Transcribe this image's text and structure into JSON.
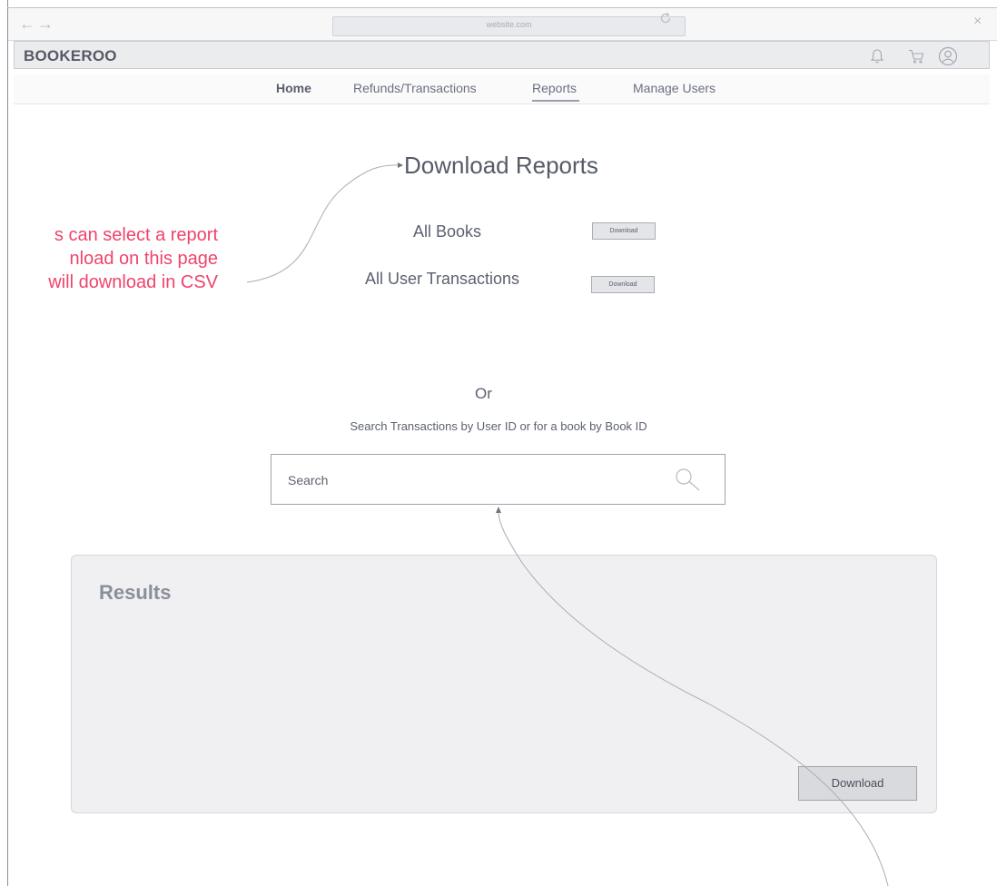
{
  "browser": {
    "url": "website.com",
    "back_glyph": "←",
    "forward_glyph": "→",
    "close_glyph": "×"
  },
  "header": {
    "brand": "BOOKEROO",
    "icons": [
      "bell-icon",
      "cart-icon",
      "user-avatar-icon"
    ]
  },
  "nav": {
    "items": [
      {
        "label": "Home",
        "active": false
      },
      {
        "label": "Refunds/Transactions",
        "active": false
      },
      {
        "label": "Reports",
        "active": true
      },
      {
        "label": "Manage Users",
        "active": false
      }
    ]
  },
  "main": {
    "title": "Download Reports",
    "reports": [
      {
        "label": "All Books",
        "button": "Download"
      },
      {
        "label": "All User Transactions",
        "button": "Download"
      }
    ],
    "or_text": "Or",
    "search_hint": "Search Transactions by User ID or for a book by Book ID",
    "search_placeholder": "Search"
  },
  "annotation": {
    "lines": [
      "s can select a report",
      "nload on this page",
      "will download in CSV"
    ],
    "color": "#f0436a"
  },
  "results": {
    "title": "Results",
    "download_label": "Download"
  }
}
